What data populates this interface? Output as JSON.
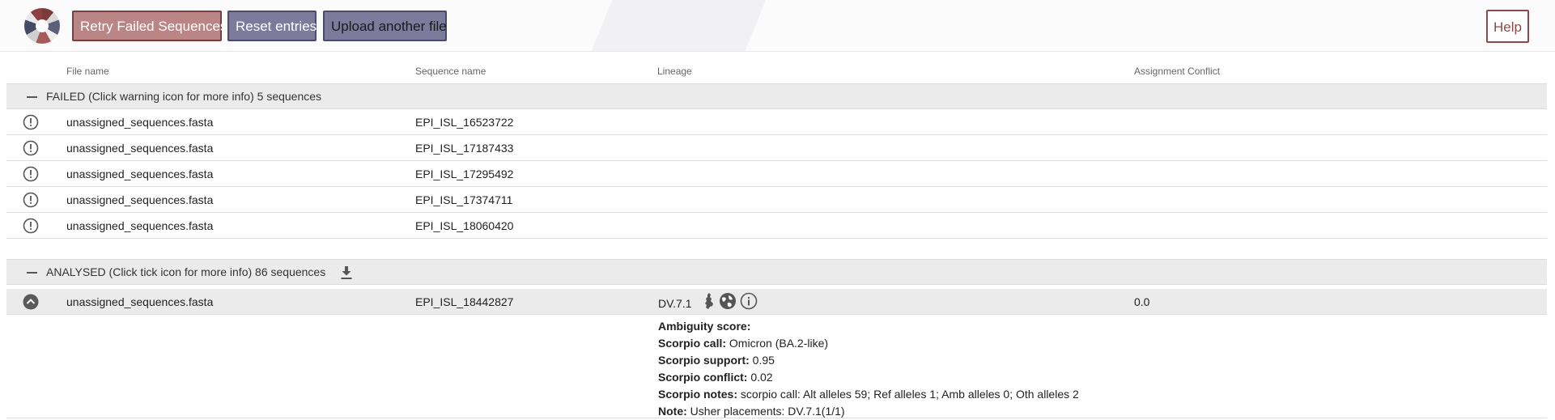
{
  "toolbar": {
    "retry_label": "Retry Failed Sequences",
    "reset_label": "Reset entries",
    "upload_label": "Upload another file",
    "help_label": "Help"
  },
  "columns": {
    "file_name": "File name",
    "sequence_name": "Sequence name",
    "lineage": "Lineage",
    "assignment_conflict": "Assignment Conflict"
  },
  "failed_group": {
    "label": "FAILED (Click warning icon for more info) 5 sequences",
    "rows": [
      {
        "file": "unassigned_sequences.fasta",
        "sequence": "EPI_ISL_16523722"
      },
      {
        "file": "unassigned_sequences.fasta",
        "sequence": "EPI_ISL_17187433"
      },
      {
        "file": "unassigned_sequences.fasta",
        "sequence": "EPI_ISL_17295492"
      },
      {
        "file": "unassigned_sequences.fasta",
        "sequence": "EPI_ISL_17374711"
      },
      {
        "file": "unassigned_sequences.fasta",
        "sequence": "EPI_ISL_18060420"
      }
    ]
  },
  "analysed_group": {
    "label": "ANALYSED (Click tick icon for more info) 86 sequences",
    "rows": [
      {
        "file": "unassigned_sequences.fasta",
        "sequence": "EPI_ISL_18442827",
        "lineage": "DV.7.1",
        "conflict": "0.0",
        "details": {
          "ambiguity_label": "Ambiguity score:",
          "ambiguity_value": "",
          "scorpio_call_label": "Scorpio call:",
          "scorpio_call_value": "Omicron (BA.2-like)",
          "scorpio_support_label": "Scorpio support:",
          "scorpio_support_value": "0.95",
          "scorpio_conflict_label": "Scorpio conflict:",
          "scorpio_conflict_value": "0.02",
          "scorpio_notes_label": "Scorpio notes:",
          "scorpio_notes_value": "scorpio call: Alt alleles 59; Ref alleles 1; Amb alleles 0; Oth alleles 2",
          "note_label": "Note:",
          "note_value": "Usher placements: DV.7.1(1/1)"
        }
      }
    ]
  },
  "icons": [
    "logo",
    "warning-icon",
    "download-icon",
    "tick-icon",
    "map-icon",
    "globe-icon",
    "info-icon"
  ],
  "colors": {
    "retry_bg": "#b98585",
    "retry_border": "#7a3e3e",
    "reset_bg": "#7d7b9c",
    "help_border": "#8a4b4b",
    "group_bg": "#ebebeb"
  }
}
